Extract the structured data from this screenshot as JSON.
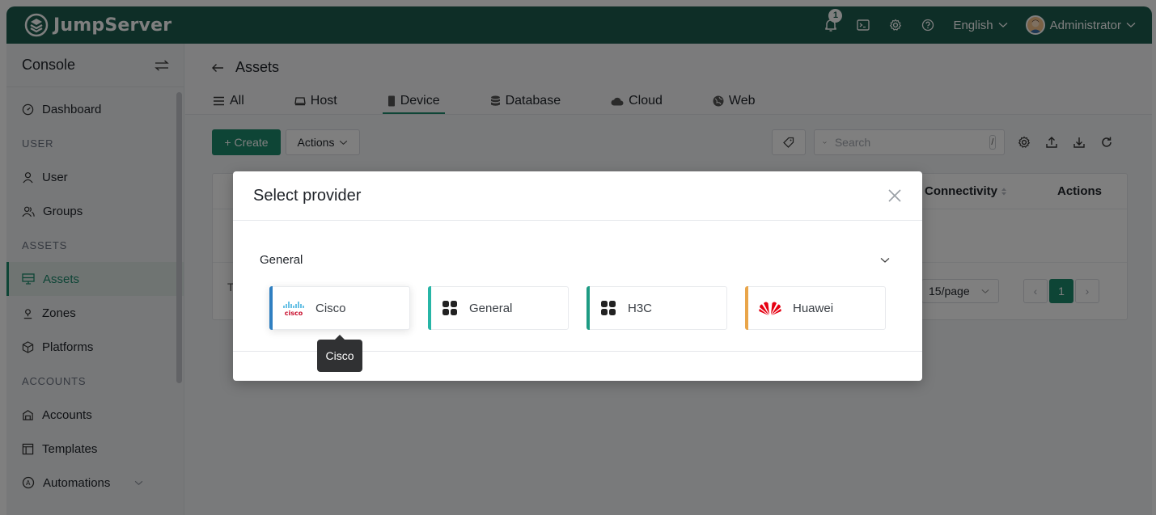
{
  "app": {
    "brand": "JumpServer"
  },
  "header": {
    "notification_count": "1",
    "language": "English",
    "user": "Administrator"
  },
  "sidebar": {
    "console_label": "Console",
    "items": [
      {
        "type": "item",
        "label": "Dashboard",
        "icon": "dashboard-icon"
      },
      {
        "type": "section",
        "label": "USER"
      },
      {
        "type": "item",
        "label": "User",
        "icon": "user-icon"
      },
      {
        "type": "item",
        "label": "Groups",
        "icon": "groups-icon"
      },
      {
        "type": "section",
        "label": "ASSETS"
      },
      {
        "type": "item",
        "label": "Assets",
        "icon": "assets-icon",
        "active": true
      },
      {
        "type": "item",
        "label": "Zones",
        "icon": "zones-icon"
      },
      {
        "type": "item",
        "label": "Platforms",
        "icon": "platforms-icon"
      },
      {
        "type": "section",
        "label": "ACCOUNTS"
      },
      {
        "type": "item",
        "label": "Accounts",
        "icon": "accounts-icon"
      },
      {
        "type": "item",
        "label": "Templates",
        "icon": "templates-icon"
      },
      {
        "type": "item",
        "label": "Automations",
        "icon": "automations-icon"
      }
    ]
  },
  "page": {
    "title": "Assets",
    "tabs": [
      {
        "label": "All",
        "icon": "list-icon"
      },
      {
        "label": "Host",
        "icon": "host-icon"
      },
      {
        "label": "Device",
        "icon": "device-icon",
        "active": true
      },
      {
        "label": "Database",
        "icon": "database-icon"
      },
      {
        "label": "Cloud",
        "icon": "cloud-icon"
      },
      {
        "label": "Web",
        "icon": "web-icon"
      }
    ]
  },
  "toolbar": {
    "create_label": "+ Create",
    "actions_label": "Actions",
    "search_placeholder": "Search",
    "search_shortcut": "/"
  },
  "table": {
    "col_connectivity": "Connectivity",
    "col_actions": "Actions",
    "total_prefix": "T",
    "page_size": "15/page",
    "current_page": "1"
  },
  "modal": {
    "title": "Select provider",
    "group_label": "General",
    "providers": [
      {
        "label": "Cisco",
        "bar_color": "#2f7fc1",
        "icon": "cisco-logo-icon",
        "logo_text": "cisco"
      },
      {
        "label": "General",
        "bar_color": "#27b5a6",
        "icon": "grid-icon"
      },
      {
        "label": "H3C",
        "bar_color": "#1d9b83",
        "icon": "grid-icon"
      },
      {
        "label": "Huawei",
        "bar_color": "#e9a54a",
        "icon": "huawei-logo-icon"
      }
    ],
    "tooltip": "Cisco"
  },
  "colors": {
    "header_bg": "#1d5c4f",
    "accent": "#1d8a6d"
  }
}
